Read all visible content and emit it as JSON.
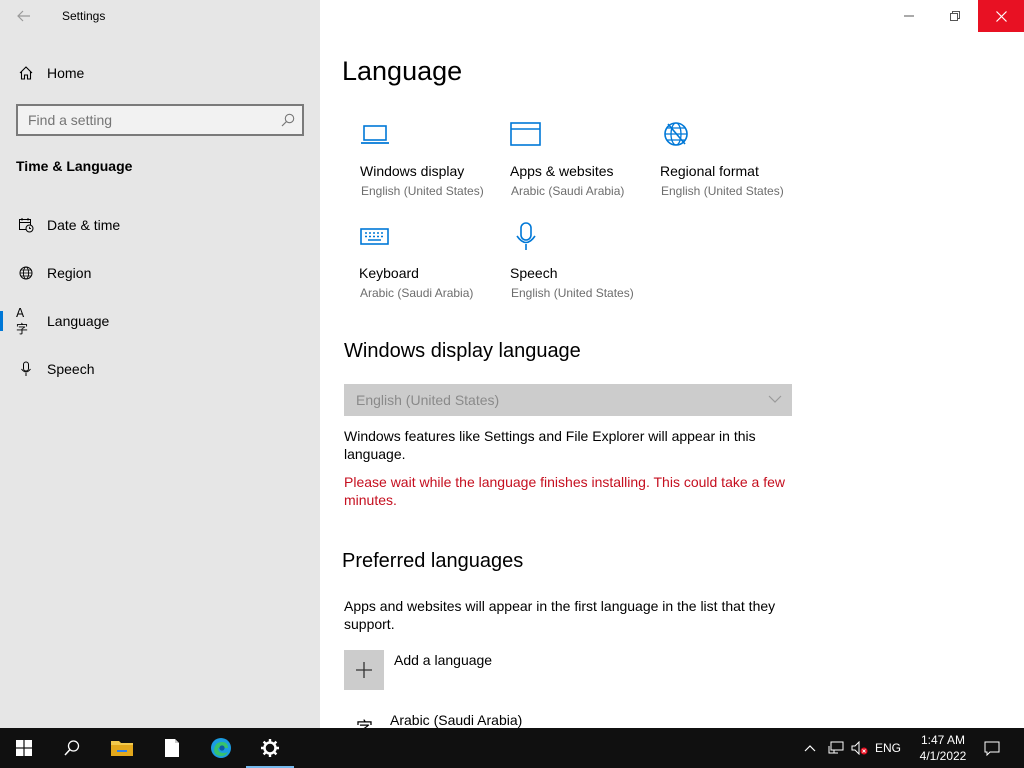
{
  "window": {
    "title": "Settings",
    "controls": {
      "minimize": "—",
      "restore": "❐",
      "close": "✕"
    }
  },
  "sidebar": {
    "home_label": "Home",
    "search_placeholder": "Find a setting",
    "section_title": "Time & Language",
    "items": [
      {
        "label": "Date & time",
        "icon": "calendar-clock-icon"
      },
      {
        "label": "Region",
        "icon": "globe-icon"
      },
      {
        "label": "Language",
        "icon": "language-icon",
        "active": true
      },
      {
        "label": "Speech",
        "icon": "microphone-icon"
      }
    ]
  },
  "main": {
    "title": "Language",
    "tiles": [
      {
        "name": "Windows display",
        "sub": "English (United States)",
        "icon": "laptop-icon"
      },
      {
        "name": "Apps & websites",
        "sub": "Arabic (Saudi Arabia)",
        "icon": "window-icon"
      },
      {
        "name": "Regional format",
        "sub": "English (United States)",
        "icon": "globe-icon"
      },
      {
        "name": "Keyboard",
        "sub": "Arabic (Saudi Arabia)",
        "icon": "keyboard-icon"
      },
      {
        "name": "Speech",
        "sub": "English (United States)",
        "icon": "microphone-icon"
      }
    ],
    "display_language": {
      "heading": "Windows display language",
      "selected": "English (United States)",
      "description": "Windows features like Settings and File Explorer will appear in this language.",
      "warning": "Please wait while the language finishes installing. This could take a few minutes."
    },
    "preferred": {
      "heading": "Preferred languages",
      "description": "Apps and websites will appear in the first language in the list that they support.",
      "add_label": "Add a language",
      "languages": [
        {
          "label": "Arabic (Saudi Arabia)"
        }
      ]
    }
  },
  "taskbar": {
    "apps": [
      "start-icon",
      "search-icon",
      "file-explorer-icon",
      "notepad-icon",
      "edge-icon",
      "settings-icon"
    ],
    "tray": {
      "input_language": "ENG",
      "time": "1:47 AM",
      "date": "4/1/2022"
    }
  },
  "colors": {
    "accent": "#0078d7",
    "warning": "#c50f1f",
    "close": "#e81123",
    "sidebar": "#e6e6e6",
    "taskbar": "#101010"
  }
}
